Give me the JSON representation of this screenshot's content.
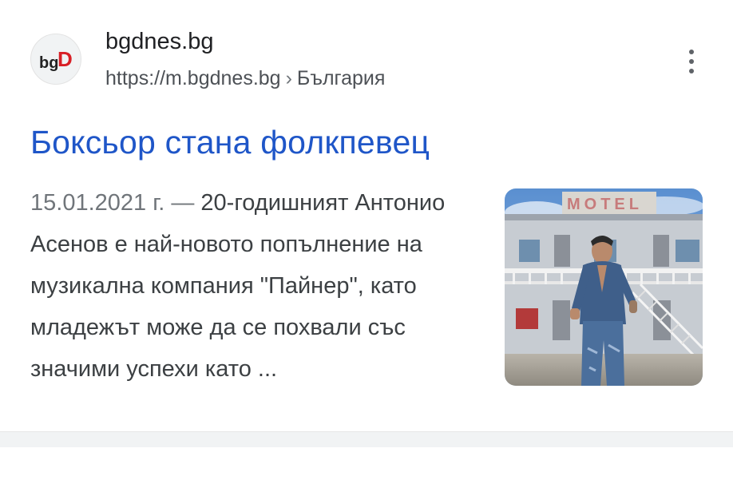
{
  "result": {
    "favicon_icon": "bgdnes-logo-icon",
    "favicon_text_a": "bg",
    "favicon_text_b": "D",
    "site_name": "bgdnes.bg",
    "url": "https://m.bgdnes.bg",
    "breadcrumb_sep": "›",
    "breadcrumb": "България",
    "more_icon": "more-vert-icon",
    "title": "Боксьор стана фолкпевец",
    "date": "15.01.2021 г.",
    "dash": " — ",
    "snippet": "20-годишният Антонио Асенов е най-новото попълнение на музикална компания \"Пайнер\", като младежът може да се похвали със значими успехи като ...",
    "thumbnail": {
      "sign_text": "MOTEL",
      "alt": "thumbnail-image"
    }
  },
  "colors": {
    "link": "#1f56c8",
    "text": "#3c4043",
    "muted": "#70757a",
    "favicon_red": "#d81f26"
  }
}
